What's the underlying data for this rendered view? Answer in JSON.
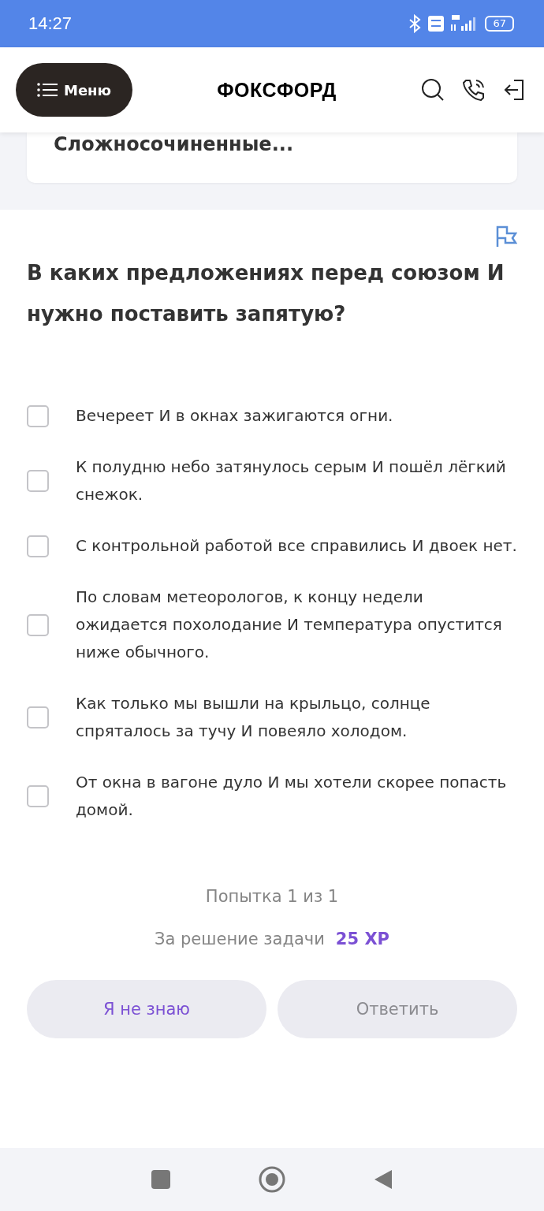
{
  "status_bar": {
    "time": "14:27",
    "battery": "67"
  },
  "header": {
    "menu_label": "Меню",
    "logo": "ФОКСФОРД"
  },
  "topic_card": {
    "title": "Сложносочиненные..."
  },
  "question": {
    "text": "В каких предложениях перед союзом И нужно поставить запятую?"
  },
  "options": [
    {
      "text": "Вечереет И в окнах зажигаются огни.",
      "checked": false
    },
    {
      "text": "К полудню небо затянулось серым И пошёл лёгкий снежок.",
      "checked": false
    },
    {
      "text": "С контрольной работой все справились И двоек нет.",
      "checked": false
    },
    {
      "text": "По словам метеорологов, к концу недели ожидается похолодание И температура опустится ниже обычного.",
      "checked": false
    },
    {
      "text": "Как только мы вышли на крыльцо, солнце спряталось за тучу И повеяло холодом.",
      "checked": false
    },
    {
      "text": "От окна в вагоне дуло И мы хотели скорее попасть домой.",
      "checked": false
    }
  ],
  "attempt": "Попытка 1 из 1",
  "reward": {
    "label": "За решение задачи",
    "value": "25 XP"
  },
  "buttons": [
    {
      "label": "Я не знаю",
      "disabled": false
    },
    {
      "label": "Ответить",
      "disabled": true
    }
  ]
}
